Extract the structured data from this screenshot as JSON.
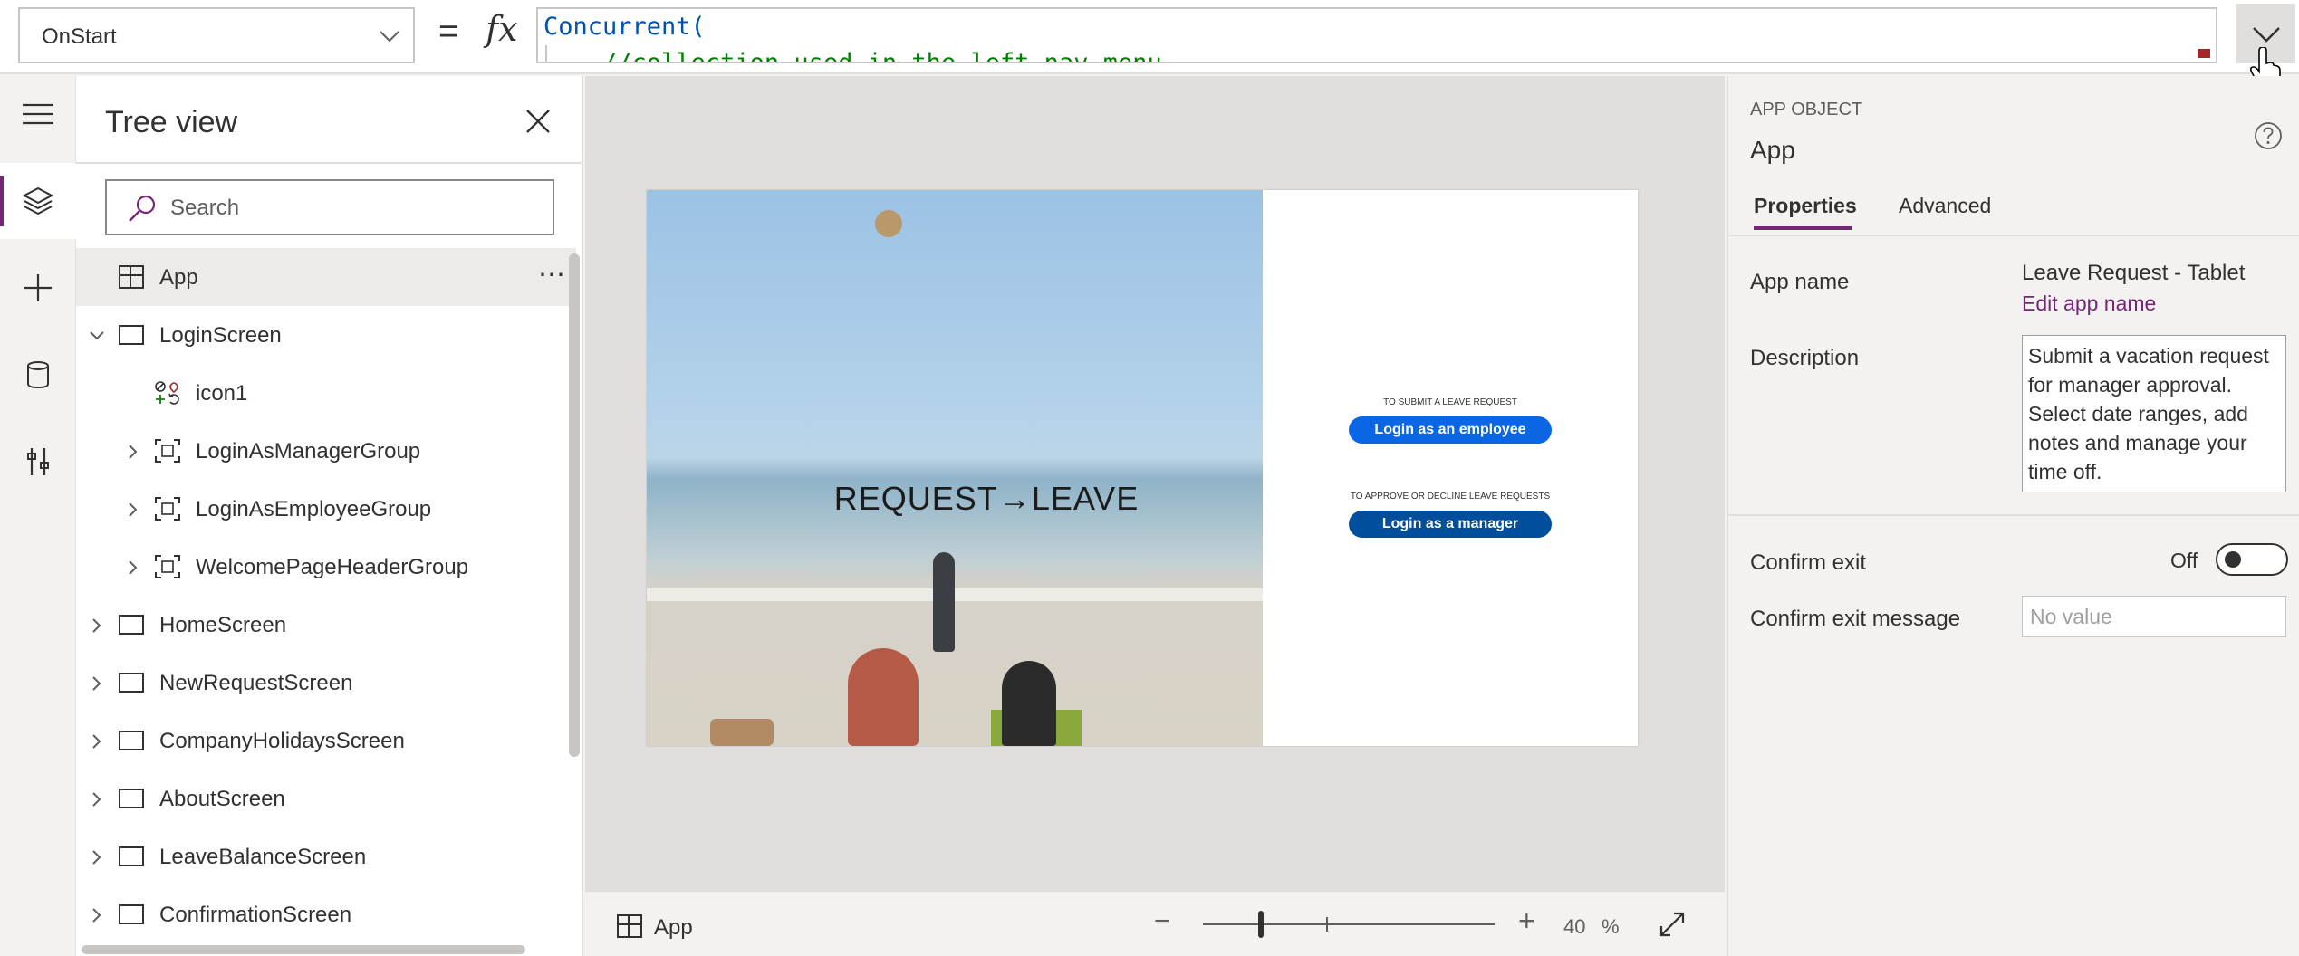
{
  "formula_bar": {
    "property": "OnStart",
    "equals": "=",
    "fx": "fx",
    "line1": "Concurrent(",
    "line2": "    //collection used in the left nav menu"
  },
  "rail": {
    "items": [
      "menu-icon",
      "layers-icon",
      "plus-icon",
      "database-icon",
      "tools-icon"
    ]
  },
  "tree": {
    "title": "Tree view",
    "search_placeholder": "Search",
    "app_label": "App",
    "app_more": "⋯",
    "items": [
      {
        "label": "LoginScreen"
      },
      {
        "label": "icon1"
      },
      {
        "label": "LoginAsManagerGroup"
      },
      {
        "label": "LoginAsEmployeeGroup"
      },
      {
        "label": "WelcomePageHeaderGroup"
      },
      {
        "label": "HomeScreen"
      },
      {
        "label": "NewRequestScreen"
      },
      {
        "label": "CompanyHolidaysScreen"
      },
      {
        "label": "AboutScreen"
      },
      {
        "label": "LeaveBalanceScreen"
      },
      {
        "label": "ConfirmationScreen"
      }
    ]
  },
  "preview": {
    "hero_title_left": "REQUEST",
    "hero_arrow": "→",
    "hero_title_right": "LEAVE",
    "employee_caption": "TO SUBMIT A LEAVE REQUEST",
    "employee_button": "Login as an employee",
    "manager_caption": "TO APPROVE OR DECLINE LEAVE REQUESTS",
    "manager_button": "Login as a manager",
    "employee_button_color": "#0a66e4",
    "manager_button_color": "#004e9c"
  },
  "canvas_bar": {
    "selected": "App",
    "zoom_minus": "−",
    "zoom_plus": "+",
    "zoom_value": "40",
    "zoom_unit": "%",
    "zoom_fraction": 0.2
  },
  "properties": {
    "kind": "APP OBJECT",
    "name": "App",
    "tab_properties": "Properties",
    "tab_advanced": "Advanced",
    "app_name_label": "App name",
    "app_name_value": "Leave Request - Tablet",
    "edit_app_name": "Edit app name",
    "description_label": "Description",
    "description_value": "Submit a vacation request for manager approval. Select date ranges, add notes and manage your time off.",
    "confirm_exit_label": "Confirm exit",
    "confirm_exit_state": "Off",
    "confirm_exit_message_label": "Confirm exit message",
    "confirm_exit_message_placeholder": "No value"
  },
  "colors": {
    "accent": "#742774"
  }
}
